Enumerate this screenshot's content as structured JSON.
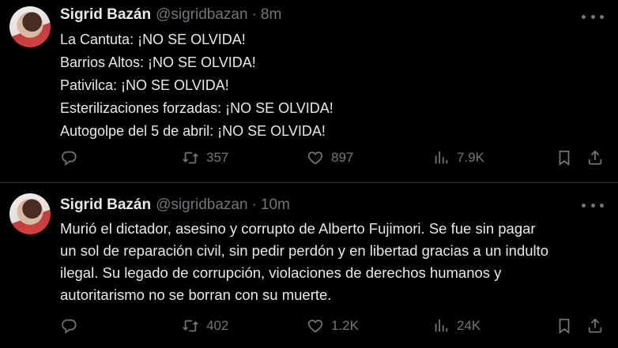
{
  "tweets": [
    {
      "name": "Sigrid Bazán",
      "handle": "@sigridbazan",
      "separator": "·",
      "time": "8m",
      "lines": [
        "La Cantuta: ¡NO SE OLVIDA!",
        "Barrios Altos: ¡NO SE OLVIDA!",
        "Pativilca: ¡NO SE OLVIDA!",
        "Esterilizaciones forzadas: ¡NO SE OLVIDA!",
        "Autogolpe del 5 de abril: ¡NO SE OLVIDA!"
      ],
      "stats": {
        "retweets": "357",
        "likes": "897",
        "views": "7.9K"
      }
    },
    {
      "name": "Sigrid Bazán",
      "handle": "@sigridbazan",
      "separator": "·",
      "time": "10m",
      "lines": [
        "Murió el dictador, asesino y corrupto de Alberto Fujimori. Se fue sin pagar",
        "un sol de reparación civil, sin pedir perdón y en libertad gracias a un indulto",
        "ilegal. Su legado de corrupción, violaciones de derechos humanos y",
        "autoritarismo no se borran con su muerte."
      ],
      "stats": {
        "retweets": "402",
        "likes": "1.2K",
        "views": "24K"
      }
    }
  ],
  "icons": {
    "avatar": "profile-photo",
    "more": "more-horizontal-icon",
    "reply": "reply-icon",
    "retweet": "retweet-icon",
    "like": "heart-icon",
    "views": "views-bar-chart-icon",
    "bookmark": "bookmark-icon",
    "share": "share-icon"
  },
  "colors": {
    "background": "#000000",
    "text": "#e7e9ea",
    "secondary": "#71767b",
    "divider": "#2f3336"
  }
}
